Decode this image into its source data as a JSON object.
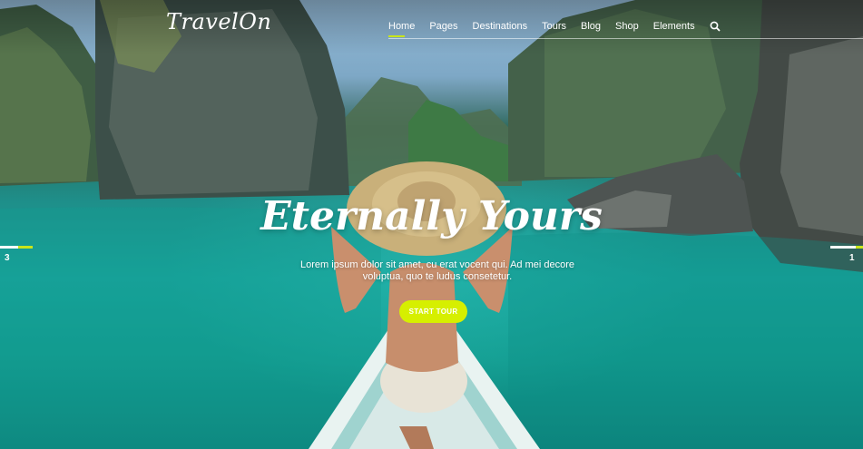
{
  "logo": {
    "text": "TravelOn"
  },
  "nav": {
    "items": [
      {
        "label": "Home"
      },
      {
        "label": "Pages"
      },
      {
        "label": "Destinations"
      },
      {
        "label": "Tours"
      },
      {
        "label": "Blog"
      },
      {
        "label": "Shop"
      },
      {
        "label": "Elements"
      }
    ],
    "search_icon": "search-icon"
  },
  "hero": {
    "headline": "Eternally Yours",
    "subtitle": "Lorem ipsum dolor sit amet, cu erat vocent qui. Ad mei decore voluptua, quo te ludus consetetur.",
    "cta_label": "START TOUR"
  },
  "slider": {
    "prev_number": "3",
    "next_number": "1"
  },
  "colors": {
    "accent": "#c9e51a",
    "button": "#d6ef00",
    "water": "#17a39b"
  }
}
